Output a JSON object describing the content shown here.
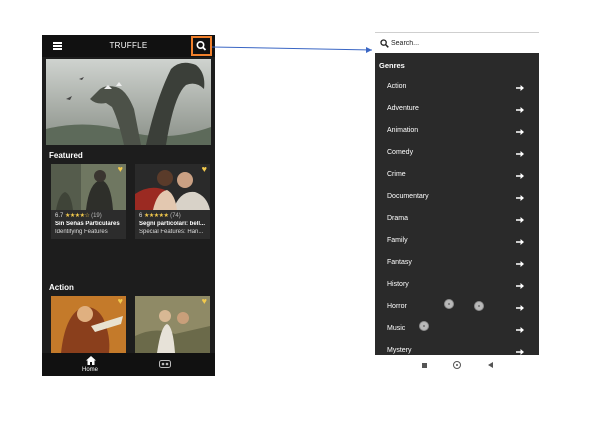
{
  "left_app": {
    "title": "TRUFFLE",
    "featured_heading": "Featured",
    "action_heading": "Action",
    "cards": [
      {
        "rating": "6.7",
        "stars": "★★★★☆",
        "count": "(19)",
        "title": "Sin Señas Particulares",
        "subtitle": "Identifying Features"
      },
      {
        "rating": "6",
        "stars": "★★★★★",
        "count": "(74)",
        "title": "Segni particolari: bell...",
        "subtitle": "Special Features: Han..."
      }
    ],
    "bottom_nav": {
      "home_label": "Home"
    }
  },
  "right_app": {
    "search_placeholder": "Search...",
    "genres_heading": "Genres",
    "genres": [
      "Action",
      "Adventure",
      "Animation",
      "Comedy",
      "Crime",
      "Documentary",
      "Drama",
      "Family",
      "Fantasy",
      "History",
      "Horror",
      "Music",
      "Mystery"
    ]
  },
  "colors": {
    "highlight": "#f0802c",
    "arrow": "#3a66c4",
    "star": "#f2c94c"
  },
  "icons": [
    "menu-icon",
    "search-icon",
    "heart-icon",
    "home-icon",
    "vr-icon",
    "chevron-right-icon"
  ]
}
